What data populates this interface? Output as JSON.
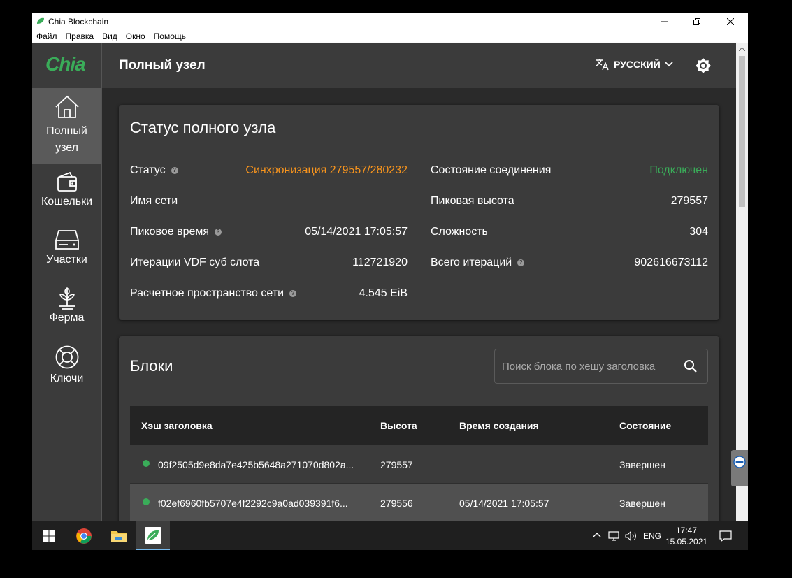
{
  "window": {
    "title": "Chia Blockchain",
    "menu": [
      "Файл",
      "Правка",
      "Вид",
      "Окно",
      "Помощь"
    ]
  },
  "appbar": {
    "logo": "Chia",
    "title": "Полный узел",
    "language": "РУССКИЙ"
  },
  "sidebar": {
    "items": [
      {
        "label_line1": "Полный",
        "label_line2": "узел",
        "icon": "home-icon"
      },
      {
        "label": "Кошельки",
        "icon": "wallet-icon"
      },
      {
        "label": "Участки",
        "icon": "hdd-icon"
      },
      {
        "label": "Ферма",
        "icon": "farm-icon"
      },
      {
        "label": "Ключи",
        "icon": "lifebuoy-icon"
      }
    ]
  },
  "status": {
    "title": "Статус полного узла",
    "rows": [
      {
        "label": "Статус",
        "value": "Синхронизация 279557/280232",
        "value_color": "#f7941d"
      },
      {
        "label": "Имя сети",
        "value": ""
      },
      {
        "label": "Пиковое время",
        "value": "05/14/2021 17:05:57"
      },
      {
        "label": "Итерации VDF суб слота",
        "value": "112721920"
      },
      {
        "label": "Расчетное пространство сети",
        "value": "4.545 EiB"
      }
    ],
    "rows_right": [
      {
        "label": "Состояние соединения",
        "value": "Подключен",
        "value_color": "#3aac59"
      },
      {
        "label": "Пиковая высота",
        "value": "279557"
      },
      {
        "label": "Сложность",
        "value": "304"
      },
      {
        "label": "Всего итераций",
        "value": "902616673112"
      }
    ]
  },
  "blocks": {
    "title": "Блоки",
    "search_placeholder": "Поиск блока по хешу заголовка",
    "headers": [
      "Хэш заголовка",
      "Высота",
      "Время создания",
      "Состояние"
    ],
    "rows": [
      {
        "hash": "09f2505d9e8da7e425b5648a271070d802a...",
        "height": "279557",
        "time": "",
        "state": "Завершен"
      },
      {
        "hash": "f02ef6960fb5707e4f2292c9a0ad039391f6...",
        "height": "279556",
        "time": "05/14/2021 17:05:57",
        "state": "Завершен"
      }
    ]
  },
  "taskbar": {
    "lang": "ENG",
    "time": "17:47",
    "date": "15.05.2021"
  },
  "colors": {
    "accent": "#3aac59",
    "warning": "#f7941d"
  }
}
